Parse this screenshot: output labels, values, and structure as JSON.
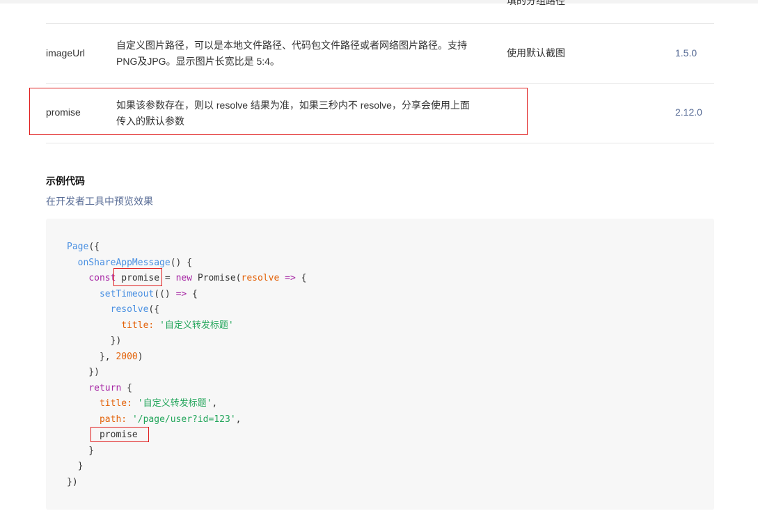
{
  "table": {
    "top_partial_text": "填的分组路径",
    "rows": [
      {
        "name": "imageUrl",
        "desc_line1": "自定义图片路径，可以是本地文件路径、代码包文件路径或者网络图片路径。支持",
        "desc_line2": "PNG及JPG。显示图片长宽比是 5:4。",
        "default": "使用默认截图",
        "version": "1.5.0"
      },
      {
        "name": "promise",
        "desc_line1": "如果该参数存在，则以 resolve 结果为准，如果三秒内不 resolve，分享会使用上面",
        "desc_line2": "传入的默认参数",
        "default": "",
        "version": "2.12.0"
      }
    ]
  },
  "example": {
    "title": "示例代码",
    "preview_link": "在开发者工具中预览效果"
  },
  "code": {
    "page": "Page",
    "on_share": "onShareAppMessage",
    "const_kw": "const",
    "promise_var": "promise",
    "new_kw": "new",
    "promise_class": "Promise",
    "resolve_param": "resolve",
    "arrow": "=>",
    "set_timeout": "setTimeout",
    "resolve_call": "resolve",
    "title_key": "title:",
    "title_value": "'自定义转发标题'",
    "timeout_ms": "2000",
    "return_kw": "return",
    "path_key": "path:",
    "path_value": "'/page/user?id=123'",
    "promise_prop": "promise"
  }
}
